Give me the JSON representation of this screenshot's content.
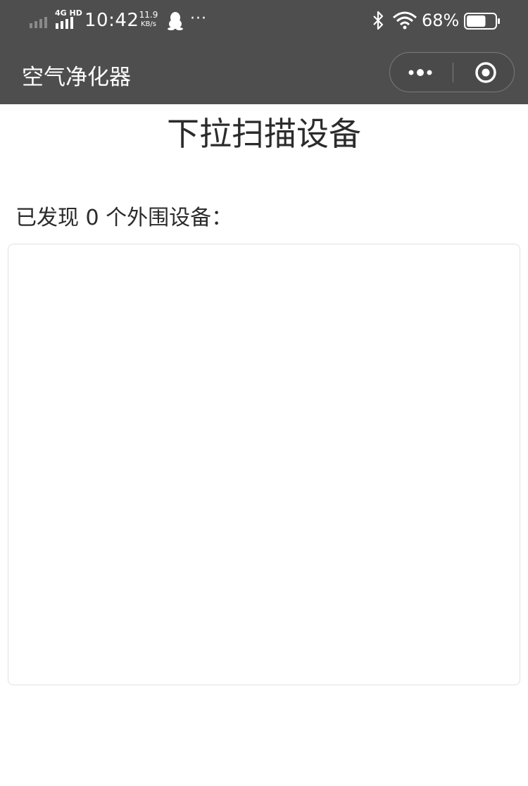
{
  "status_bar": {
    "network": "4G HD",
    "time": "10:42",
    "speed_value": "11.9",
    "speed_unit": "KB/s",
    "more": "···",
    "battery": "68%",
    "battery_level": 0.68
  },
  "nav": {
    "title": "空气净化器"
  },
  "main": {
    "title": "下拉扫描设备",
    "found_label": "已发现 0 个外围设备："
  },
  "colors": {
    "bar_bg": "#4e4e4e",
    "text": "#2b2b2b",
    "border": "#e2e2e2"
  }
}
